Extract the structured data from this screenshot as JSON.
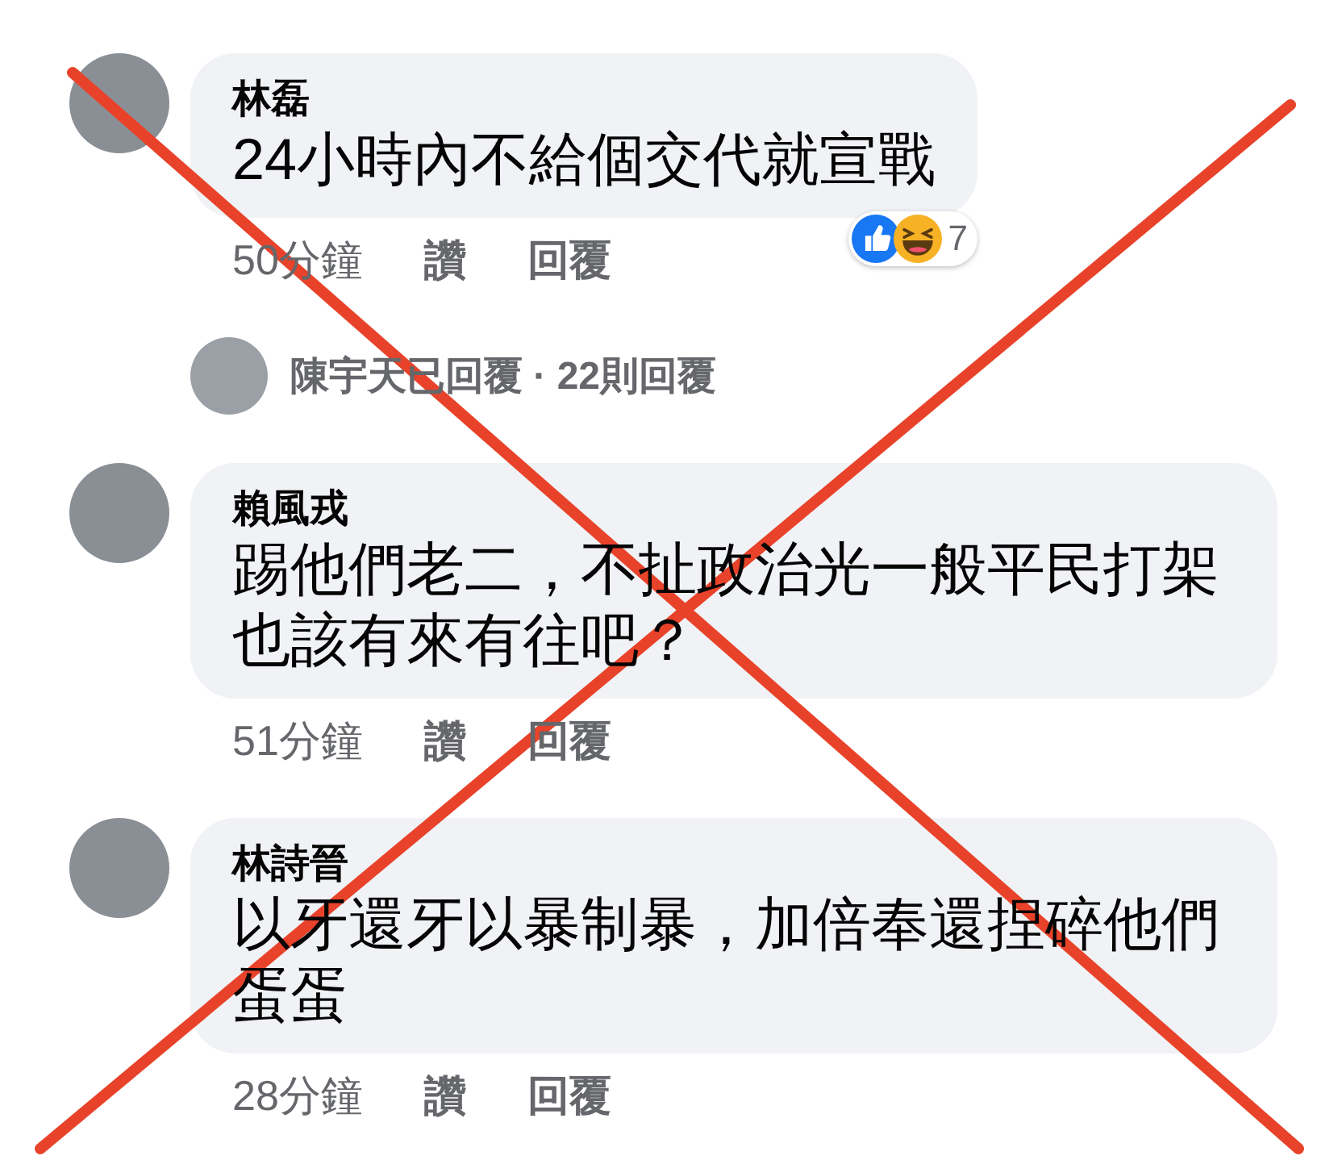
{
  "comments": [
    {
      "author": "林磊",
      "text": "24小時內不給個交代就宣戰",
      "time": "50分鐘",
      "like": "讚",
      "reply": "回覆",
      "reactions": {
        "count": "7"
      },
      "replies_summary": "陳宇天已回覆 · 22則回覆"
    },
    {
      "author": "賴風戎",
      "text": "踢他們老二，不扯政治光一般平民打架也該有來有往吧？",
      "time": "51分鐘",
      "like": "讚",
      "reply": "回覆"
    },
    {
      "author": "林詩晉",
      "text": "以牙還牙以暴制暴，加倍奉還捏碎他們蛋蛋",
      "time": "28分鐘",
      "like": "讚",
      "reply": "回覆"
    }
  ]
}
